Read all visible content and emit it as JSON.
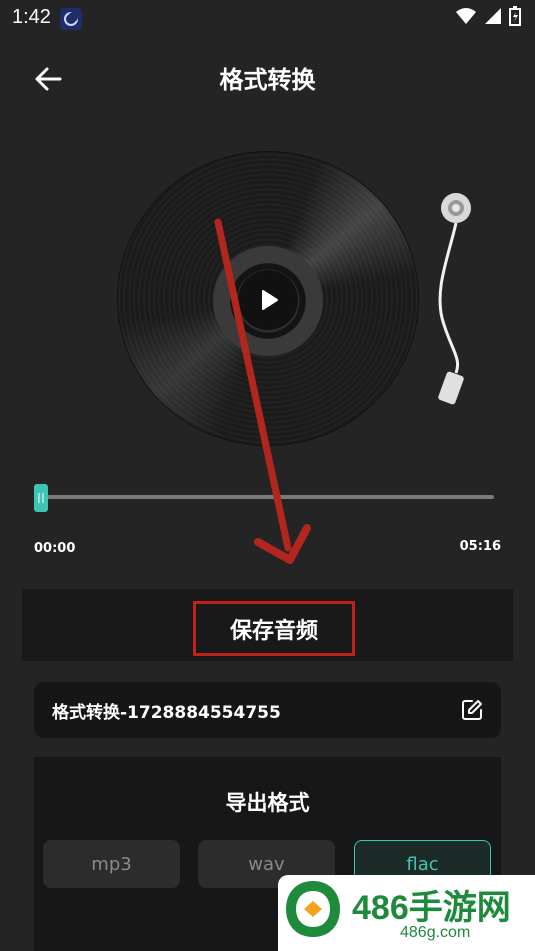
{
  "status_bar": {
    "time": "1:42"
  },
  "header": {
    "title": "格式转换"
  },
  "player": {
    "current_time": "00:00",
    "total_time": "05:16",
    "progress": 0.0
  },
  "save": {
    "label": "保存音频"
  },
  "file": {
    "name": "格式转换-1728884554755"
  },
  "export": {
    "title": "导出格式",
    "formats": [
      "mp3",
      "wav",
      "flac"
    ],
    "selected": "flac"
  },
  "watermark": {
    "title": "486手游网",
    "domain": "486g.com"
  },
  "colors": {
    "accent": "#3fc5b3",
    "annotation": "#c0211a",
    "background": "#242424"
  }
}
